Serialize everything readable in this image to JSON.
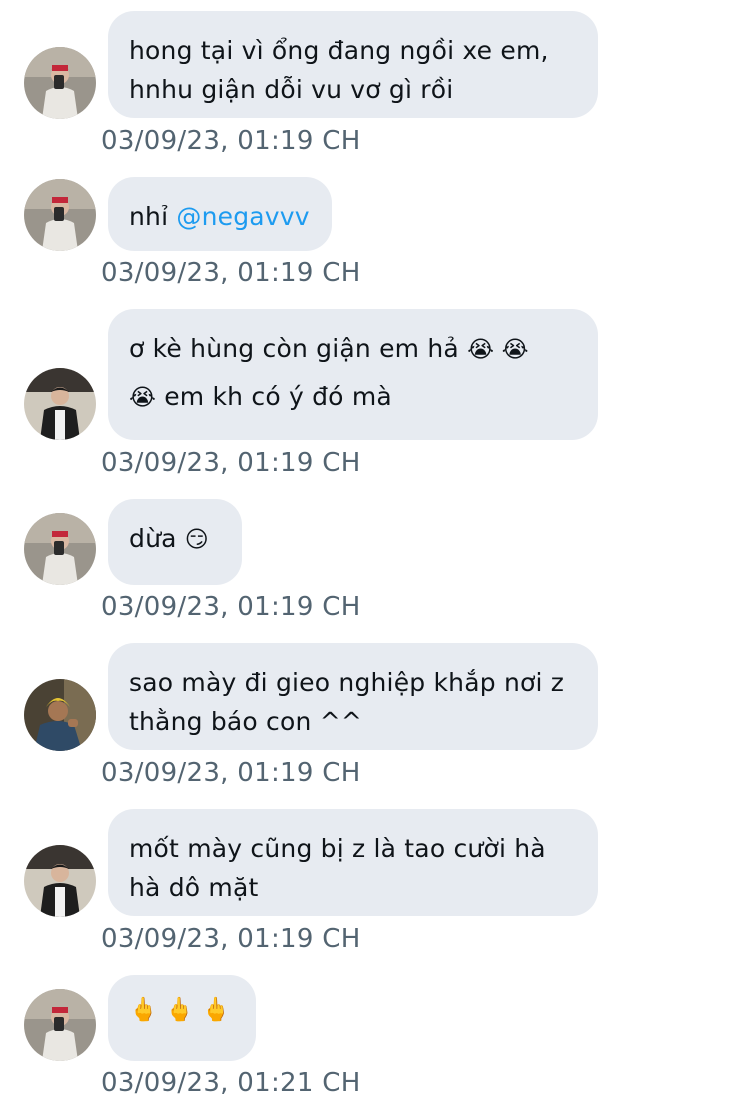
{
  "messages": [
    {
      "sender": "user-red-cap",
      "lines": [
        "hong tại vì ổng đang ngồi xe em,",
        "hnhu giận dỗi vu vơ gì rồi"
      ],
      "timestamp": "03/09/23, 01:19 CH"
    },
    {
      "sender": "user-red-cap",
      "text": "nhỉ ",
      "mention": "@negavvv",
      "timestamp": "03/09/23, 01:19 CH"
    },
    {
      "sender": "user-dark-jacket",
      "line1_text": "ơ kè hùng còn giận em hả ",
      "line1_emoji": "😭 😭",
      "line2_emoji": "😭",
      "line2_text": "  em kh có ý đó mà",
      "timestamp": "03/09/23, 01:19 CH"
    },
    {
      "sender": "user-red-cap",
      "text": "dừa ",
      "emoji": "😏",
      "timestamp": "03/09/23, 01:19 CH"
    },
    {
      "sender": "user-yellow-hair",
      "lines": [
        "sao mày đi gieo nghiệp khắp nơi z",
        "thằng báo con ^^"
      ],
      "timestamp": "03/09/23, 01:19 CH"
    },
    {
      "sender": "user-dark-jacket",
      "lines": [
        "mốt mày cũng bị z là tao cười hà",
        "hà dô mặt"
      ],
      "timestamp": "03/09/23, 01:19 CH"
    },
    {
      "sender": "user-red-cap",
      "emoji": "🖕 🖕 🖕",
      "timestamp": "03/09/23, 01:21 CH"
    }
  ],
  "colors": {
    "bubble": "#e7ebf1",
    "text": "#0f1419",
    "mention": "#1d9bf0",
    "timestamp": "#536471"
  },
  "icons": {
    "avatar_red_cap": "avatar-red-cap-photo",
    "avatar_dark_jacket": "avatar-dark-jacket-photo",
    "avatar_yellow_hair": "avatar-yellow-hair-photo"
  }
}
